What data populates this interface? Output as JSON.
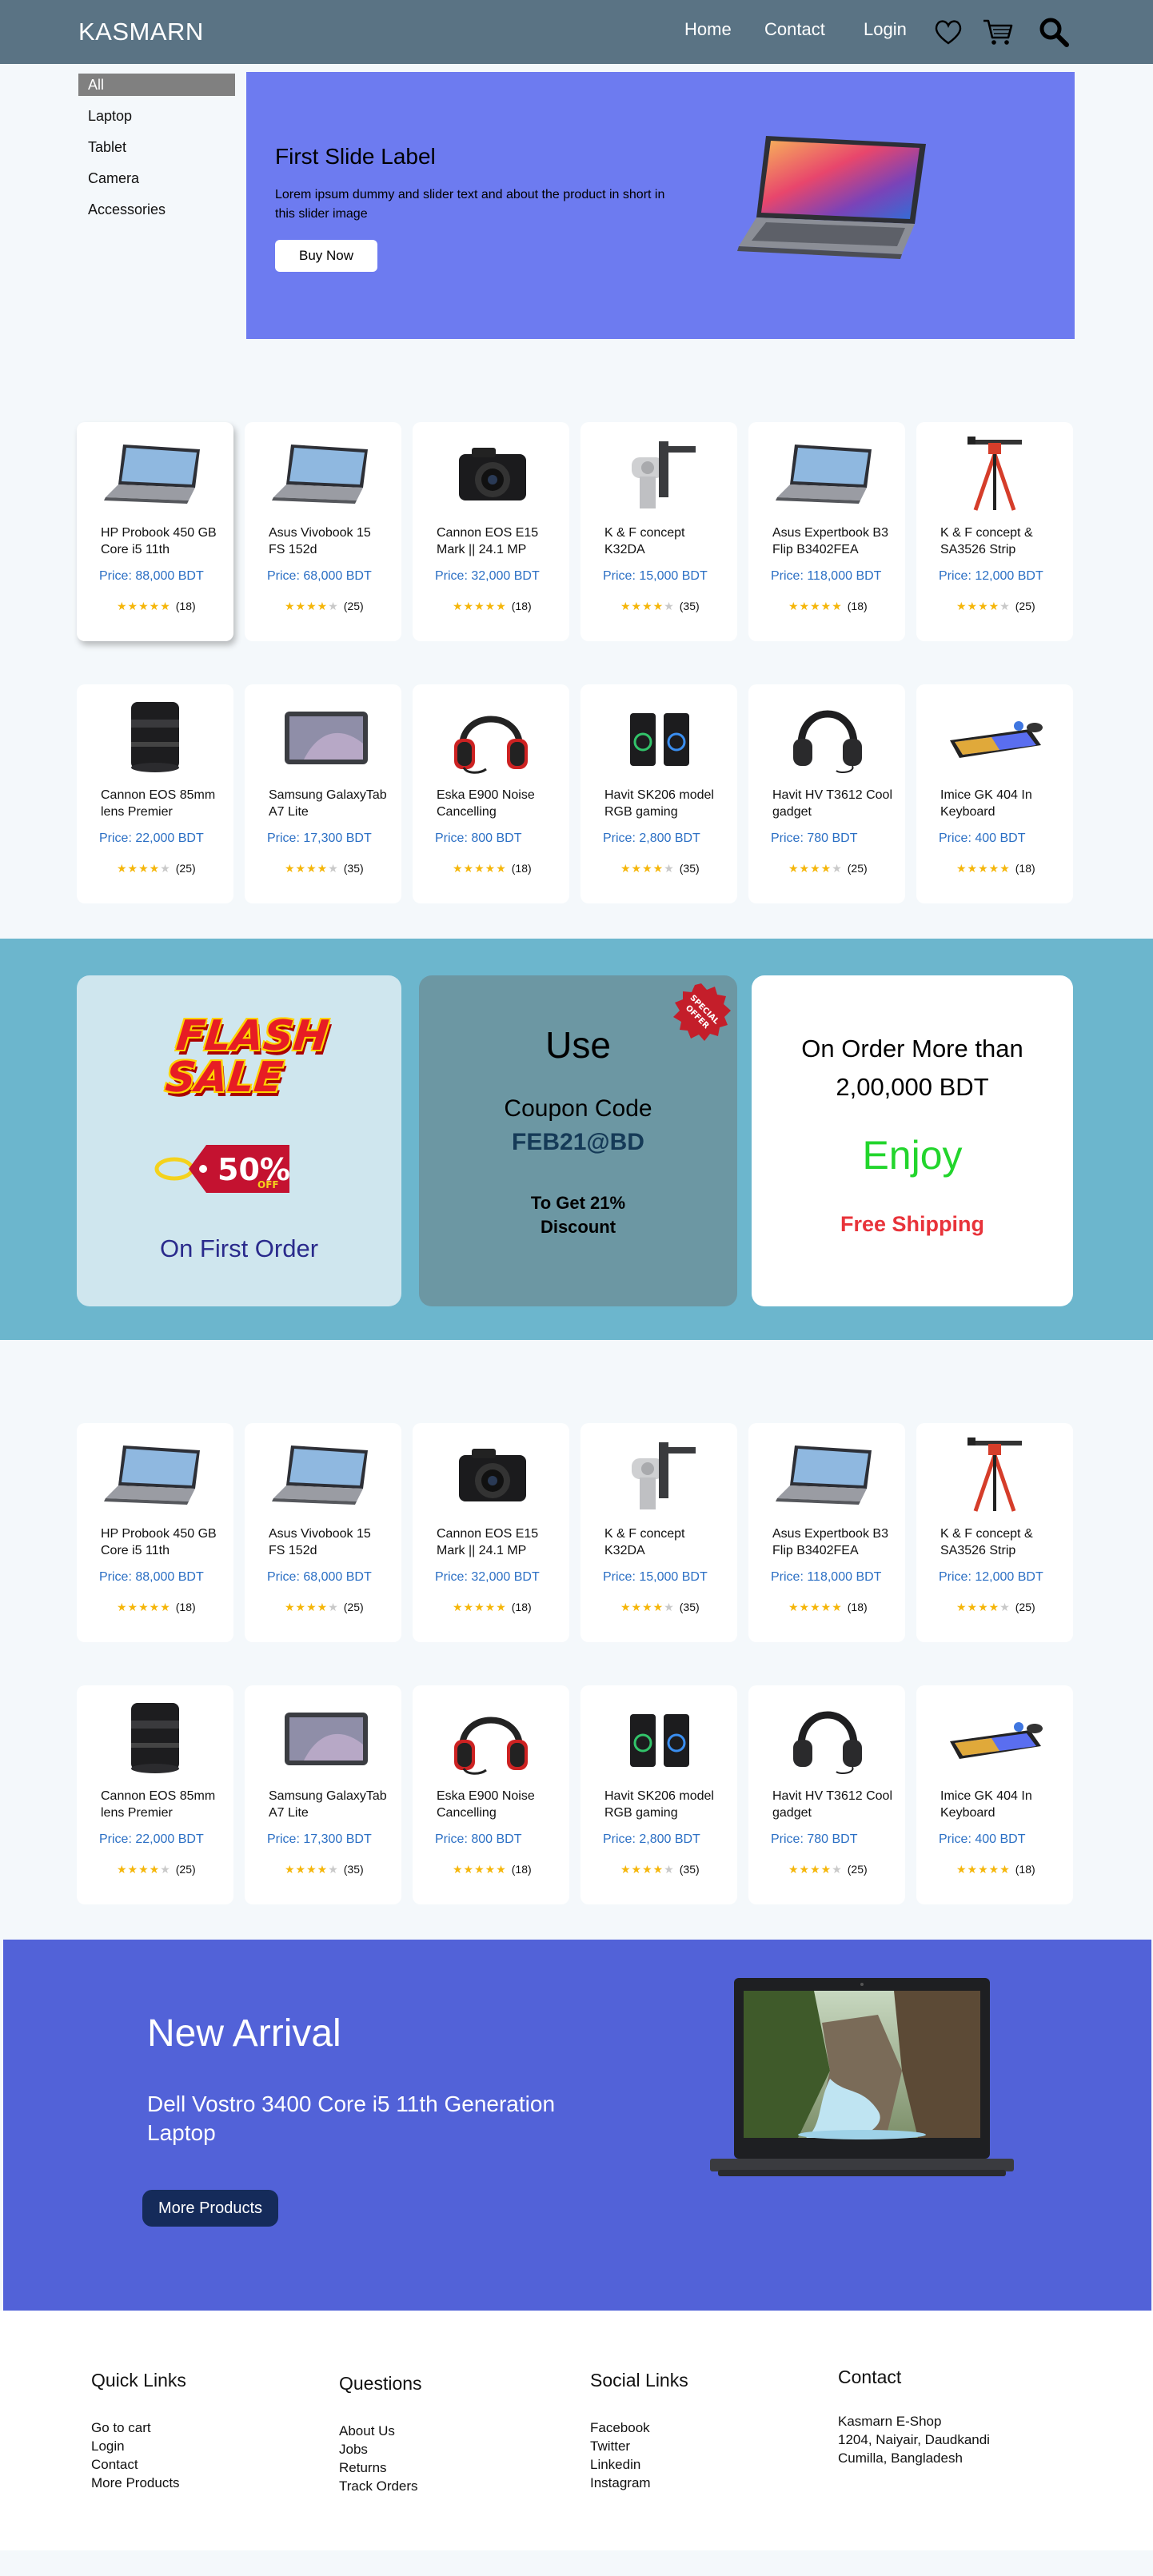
{
  "header": {
    "brand": "KASMARN",
    "nav": [
      "Home",
      "Contact",
      "Login"
    ]
  },
  "sidebar": {
    "items": [
      "All",
      "Laptop",
      "Tablet",
      "Camera",
      "Accessories"
    ]
  },
  "hero": {
    "title": "First Slide Label",
    "text": "Lorem ipsum dummy and slider text and about the product in short in this slider image",
    "button": "Buy Now"
  },
  "products": [
    {
      "name": "HP Probook 450 GB Core i5 11th",
      "price": "Price:  88,000 BDT",
      "stars": 4.5,
      "count": "(18)",
      "image": "laptop-icon"
    },
    {
      "name": "Asus Vivobook 15 FS 152d",
      "price": "Price:  68,000 BDT",
      "stars": 4,
      "count": "(25)",
      "image": "laptop-icon"
    },
    {
      "name": "Cannon EOS E15 Mark || 24.1 MP",
      "price": "Price:  32,000 BDT",
      "stars": 4.5,
      "count": "(18)",
      "image": "camera-icon"
    },
    {
      "name": "K & F concept K32DA",
      "price": "Price:  15,000 BDT",
      "stars": 3.5,
      "count": "(35)",
      "image": "tripod-head-icon"
    },
    {
      "name": "Asus  Expertbook B3 Flip B3402FEA",
      "price": "Price:  118,000 BDT",
      "stars": 4.5,
      "count": "(18)",
      "image": "laptop-icon"
    },
    {
      "name": "K & F concept & SA3526 Strip",
      "price": "Price:  12,000 BDT",
      "stars": 4,
      "count": "(25)",
      "image": "tripod-icon"
    },
    {
      "name": "Cannon EOS 85mm lens Premier",
      "price": "Price:  22,000 BDT",
      "stars": 4,
      "count": "(25)",
      "image": "lens-icon"
    },
    {
      "name": "Samsung GalaxyTab A7 Lite",
      "price": "Price:  17,300 BDT",
      "stars": 3.5,
      "count": "(35)",
      "image": "tablet-icon"
    },
    {
      "name": "Eska E900 Noise Cancelling",
      "price": "Price:  800 BDT",
      "stars": 4.5,
      "count": "(18)",
      "image": "headset-icon"
    },
    {
      "name": "Havit SK206 model RGB gaming",
      "price": "Price:  2,800 BDT",
      "stars": 3.5,
      "count": "(35)",
      "image": "speaker-icon"
    },
    {
      "name": "Havit HV T3612 Cool gadget",
      "price": "Price:  780 BDT",
      "stars": 4,
      "count": "(25)",
      "image": "headphones-icon"
    },
    {
      "name": "Imice GK 404 In Keyboard",
      "price": "Price:  400 BDT",
      "stars": 4.5,
      "count": "(18)",
      "image": "keyboard-icon"
    }
  ],
  "promo": {
    "flash_line1": "FLASH",
    "flash_line2": "SALE",
    "discount": "50%",
    "discount_off": "OFF",
    "first_order": "On First Order",
    "use": "Use",
    "coupon_label": "Coupon Code",
    "coupon_code": "FEB21@BD",
    "get_line1": "To Get 21%",
    "get_line2": "Discount",
    "seal_line1": "SPECIAL",
    "seal_line2": "OFFER",
    "order_line1": "On Order More than",
    "order_line2": "2,00,000 BDT",
    "enjoy": "Enjoy",
    "shipping": "Free Shipping"
  },
  "arrival": {
    "title": "New Arrival",
    "subtitle": "Dell Vostro 3400 Core i5 11th Generation Laptop",
    "button": "More Products"
  },
  "footer": {
    "quick_links": {
      "title": "Quick Links",
      "items": [
        "Go to cart",
        "Login",
        "Contact",
        "More Products"
      ]
    },
    "questions": {
      "title": "Questions",
      "items": [
        "About Us",
        "Jobs",
        "Returns",
        "Track Orders"
      ]
    },
    "social": {
      "title": "Social Links",
      "items": [
        "Facebook",
        "Twitter",
        "Linkedin",
        "Instagram"
      ]
    },
    "contact": {
      "title": "Contact",
      "lines": [
        "Kasmarn E-Shop",
        "1204, Naiyair, Daudkandi",
        "Cumilla, Bangladesh"
      ]
    }
  },
  "colors": {
    "header": "#5a7384",
    "hero": "#6d7bf0",
    "price": "#2b6fc4",
    "star": "#f5b60a",
    "promo_band": "#6cb6cd",
    "arrival": "#5262d8"
  }
}
